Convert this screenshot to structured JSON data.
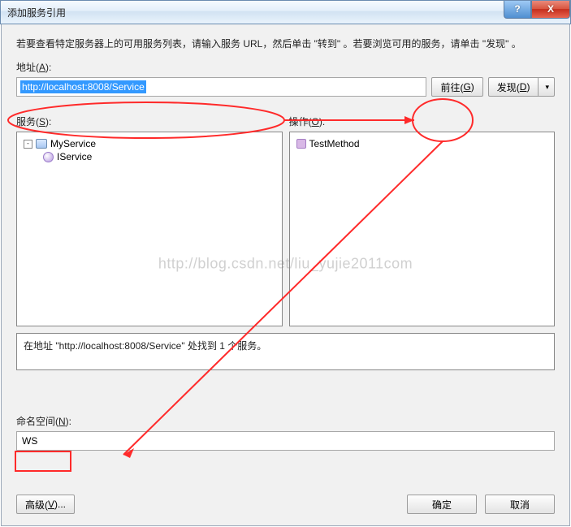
{
  "window": {
    "title": "添加服务引用",
    "help_glyph": "?",
    "close_glyph": "X"
  },
  "intro": "若要查看特定服务器上的可用服务列表，请输入服务 URL，然后单击 \"转到\" 。若要浏览可用的服务，请单击 \"发现\" 。",
  "address": {
    "label_prefix": "地址(",
    "label_key": "A",
    "label_suffix": "):",
    "value": "http://localhost:8008/Service"
  },
  "go_button": {
    "text": "前往(",
    "key": "G",
    "suffix": ")"
  },
  "discover_button": {
    "text": "发现(",
    "key": "D",
    "suffix": ")"
  },
  "services": {
    "label_prefix": "服务(",
    "label_key": "S",
    "label_suffix": "):",
    "items": [
      {
        "icon": "svc",
        "text": "MyService",
        "expander": "-"
      },
      {
        "icon": "iface",
        "text": "IService",
        "indent": true
      }
    ]
  },
  "operations": {
    "label_prefix": "操作(",
    "label_key": "O",
    "label_suffix": "):",
    "items": [
      {
        "icon": "op",
        "text": "TestMethod"
      }
    ]
  },
  "status": "在地址 \"http://localhost:8008/Service\" 处找到 1 个服务。",
  "namespace": {
    "label_prefix": "命名空间(",
    "label_key": "N",
    "label_suffix": "):",
    "value": "WS"
  },
  "advanced_button": {
    "text": "高级(",
    "key": "V",
    "suffix": ")..."
  },
  "ok_button": "确定",
  "cancel_button": "取消",
  "watermark": "http://blog.csdn.net/liu_yujie2011com"
}
